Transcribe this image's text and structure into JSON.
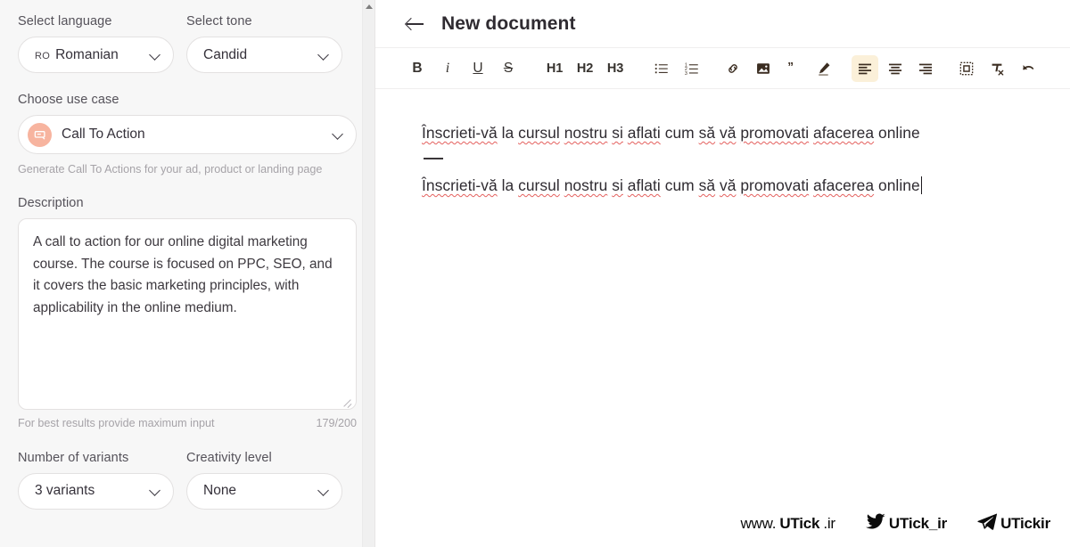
{
  "colors": {
    "panel_bg": "#f7f7f7",
    "accent_badge": "#f7b49f",
    "toolbar_active": "#fbf0d9",
    "spellcheck_underline": "#e4605e",
    "text_primary": "#2f2b31",
    "text_muted": "#a6a3a8"
  },
  "sidebar": {
    "language": {
      "label": "Select language",
      "code": "RO",
      "value": "Romanian",
      "chevron_icon": "chevron-down-icon"
    },
    "tone": {
      "label": "Select tone",
      "value": "Candid",
      "chevron_icon": "chevron-down-icon"
    },
    "use_case": {
      "label": "Choose use case",
      "value": "Call To Action",
      "badge_icon": "call-to-action-banner-icon",
      "chevron_icon": "chevron-down-icon",
      "helper": "Generate Call To Actions for your ad, product or landing page"
    },
    "description": {
      "label": "Description",
      "value": "A call to action for our online digital marketing course. The course is focused on PPC, SEO, and it covers the basic marketing principles, with applicability in the online medium.",
      "placeholder": "Description",
      "hint": "For best results provide maximum input",
      "counter": "179/200",
      "resize_icon": "resize-handle-icon"
    },
    "variants": {
      "label": "Number of variants",
      "value": "3 variants",
      "chevron_icon": "chevron-down-icon"
    },
    "creativity": {
      "label": "Creativity level",
      "value": "None",
      "chevron_icon": "chevron-down-icon"
    },
    "scrollbar": {
      "up_arrow_icon": "scroll-up-arrow-icon"
    }
  },
  "editor": {
    "back_icon": "arrow-left-icon",
    "title": "New document",
    "toolbar": [
      {
        "name": "bold-button",
        "label": "B",
        "kind": "text",
        "style": "bold",
        "active": false
      },
      {
        "name": "italic-button",
        "label": "i",
        "kind": "text",
        "style": "italic",
        "active": false
      },
      {
        "name": "underline-button",
        "label": "U",
        "kind": "text",
        "style": "under",
        "active": false
      },
      {
        "name": "strikethrough-button",
        "label": "S",
        "kind": "text",
        "style": "strike",
        "active": false
      },
      {
        "name": "heading-1-button",
        "label": "H1",
        "kind": "text",
        "style": "head",
        "active": false
      },
      {
        "name": "heading-2-button",
        "label": "H2",
        "kind": "text",
        "style": "head",
        "active": false
      },
      {
        "name": "heading-3-button",
        "label": "H3",
        "kind": "text",
        "style": "head",
        "active": false
      },
      {
        "name": "bulleted-list-button",
        "label": "bulleted-list-icon",
        "kind": "icon",
        "active": false
      },
      {
        "name": "numbered-list-button",
        "label": "numbered-list-icon",
        "kind": "icon",
        "active": false
      },
      {
        "name": "insert-link-button",
        "label": "link-icon",
        "kind": "icon",
        "active": false
      },
      {
        "name": "insert-image-button",
        "label": "image-icon",
        "kind": "icon",
        "active": false
      },
      {
        "name": "blockquote-button",
        "label": "quote-icon",
        "kind": "icon",
        "active": false
      },
      {
        "name": "highlighter-button",
        "label": "pen-highlight-icon",
        "kind": "icon",
        "active": false
      },
      {
        "name": "align-left-button",
        "label": "align-left-icon",
        "kind": "icon",
        "active": true
      },
      {
        "name": "align-center-button",
        "label": "align-center-icon",
        "kind": "icon",
        "active": false
      },
      {
        "name": "align-right-button",
        "label": "align-right-icon",
        "kind": "icon",
        "active": false
      },
      {
        "name": "insert-block-button",
        "label": "dashed-frame-icon",
        "kind": "icon",
        "active": false
      },
      {
        "name": "clear-format-button",
        "label": "clear-formatting-icon",
        "kind": "icon",
        "active": false
      },
      {
        "name": "undo-button",
        "label": "undo-arrow-icon",
        "kind": "icon",
        "active": false
      }
    ],
    "content": {
      "paragraph_1": {
        "segments": [
          {
            "text": "Înscrieti-vă",
            "spellcheck": true
          },
          {
            "text": " la ",
            "spellcheck": false
          },
          {
            "text": "cursul",
            "spellcheck": true
          },
          {
            "text": " ",
            "spellcheck": false
          },
          {
            "text": "nostru",
            "spellcheck": true
          },
          {
            "text": " ",
            "spellcheck": false
          },
          {
            "text": "si",
            "spellcheck": true
          },
          {
            "text": " ",
            "spellcheck": false
          },
          {
            "text": "aflati",
            "spellcheck": true
          },
          {
            "text": " cum ",
            "spellcheck": false
          },
          {
            "text": "să",
            "spellcheck": true
          },
          {
            "text": " ",
            "spellcheck": false
          },
          {
            "text": "vă",
            "spellcheck": true
          },
          {
            "text": " ",
            "spellcheck": false
          },
          {
            "text": "promovati",
            "spellcheck": true
          },
          {
            "text": " ",
            "spellcheck": false
          },
          {
            "text": "afacerea",
            "spellcheck": true
          },
          {
            "text": " online",
            "spellcheck": false
          }
        ]
      },
      "divider": "—",
      "paragraph_2": {
        "segments": [
          {
            "text": "Înscrieti-vă",
            "spellcheck": true
          },
          {
            "text": " la ",
            "spellcheck": false
          },
          {
            "text": "cursul",
            "spellcheck": true
          },
          {
            "text": " ",
            "spellcheck": false
          },
          {
            "text": "nostru",
            "spellcheck": true
          },
          {
            "text": " ",
            "spellcheck": false
          },
          {
            "text": "si",
            "spellcheck": true
          },
          {
            "text": " ",
            "spellcheck": false
          },
          {
            "text": "aflati",
            "spellcheck": true
          },
          {
            "text": " cum ",
            "spellcheck": false
          },
          {
            "text": "să",
            "spellcheck": true
          },
          {
            "text": " ",
            "spellcheck": false
          },
          {
            "text": "vă",
            "spellcheck": true
          },
          {
            "text": " ",
            "spellcheck": false
          },
          {
            "text": "promovati",
            "spellcheck": true
          },
          {
            "text": " ",
            "spellcheck": false
          },
          {
            "text": "afacerea",
            "spellcheck": true
          },
          {
            "text": " online",
            "spellcheck": false
          }
        ],
        "caret": true
      }
    }
  },
  "watermarks": [
    {
      "name": "website-watermark",
      "icon": "",
      "lead": "www.",
      "brand": "UTick",
      "tld": ".ir"
    },
    {
      "name": "twitter-watermark",
      "icon": "twitter-icon",
      "handle": "UTick_ir"
    },
    {
      "name": "telegram-watermark",
      "icon": "telegram-icon",
      "handle": "UTickir"
    }
  ]
}
